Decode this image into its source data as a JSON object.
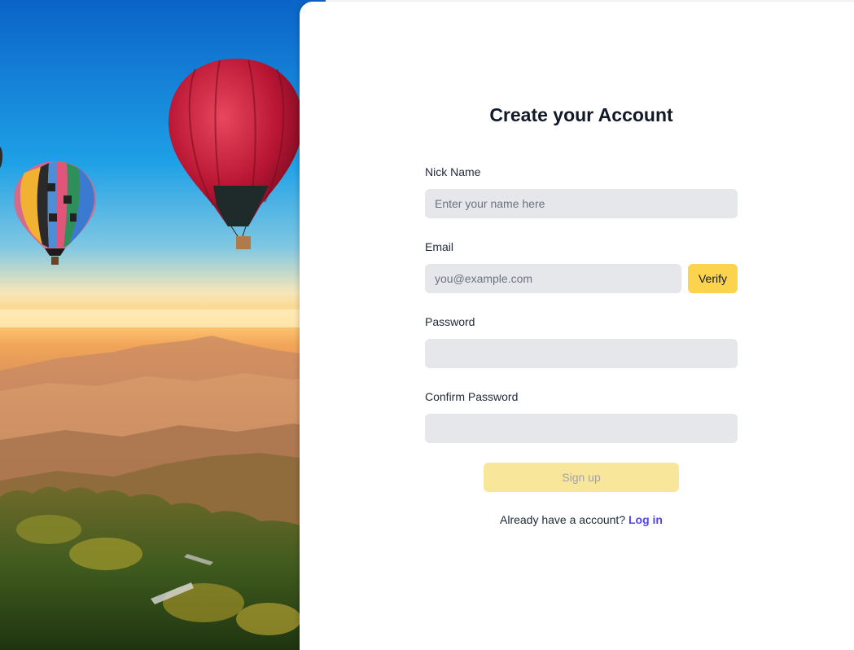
{
  "hero": {
    "description_icon": "hot-air-balloons-landscape-image"
  },
  "form": {
    "title": "Create your Account",
    "nickname": {
      "label": "Nick Name",
      "placeholder": "Enter your name here",
      "value": ""
    },
    "email": {
      "label": "Email",
      "placeholder": "you@example.com",
      "value": "",
      "verify_label": "Verify"
    },
    "password": {
      "label": "Password",
      "value": ""
    },
    "confirm_password": {
      "label": "Confirm Password",
      "value": ""
    },
    "signup_label": "Sign up",
    "login_prompt": "Already have a account?",
    "login_link": "Log in"
  },
  "colors": {
    "accent_yellow": "#fcd34d",
    "disabled_yellow": "#f8e79a",
    "link": "#4f46e5",
    "input_bg": "#e5e7eb"
  }
}
